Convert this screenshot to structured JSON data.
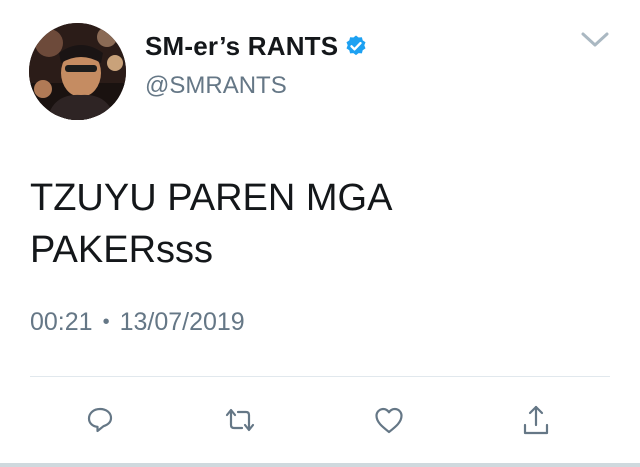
{
  "author": {
    "display_name": "SM-er’s RANTS",
    "handle": "@SMRANTS",
    "verified": true
  },
  "tweet": {
    "lines": [
      "TZUYU PAREN MGA",
      "PAKERsss"
    ],
    "time": "00:21",
    "separator": "•",
    "date": "13/07/2019"
  },
  "icons": {
    "more": "chevron-down-icon",
    "verified": "verified-badge-icon",
    "reply": "reply-icon",
    "retweet": "retweet-icon",
    "like": "heart-icon",
    "share": "share-icon"
  },
  "colors": {
    "text": "#14171a",
    "secondary": "#657786",
    "verified": "#1da1f2",
    "divider": "#e1e8ed"
  }
}
